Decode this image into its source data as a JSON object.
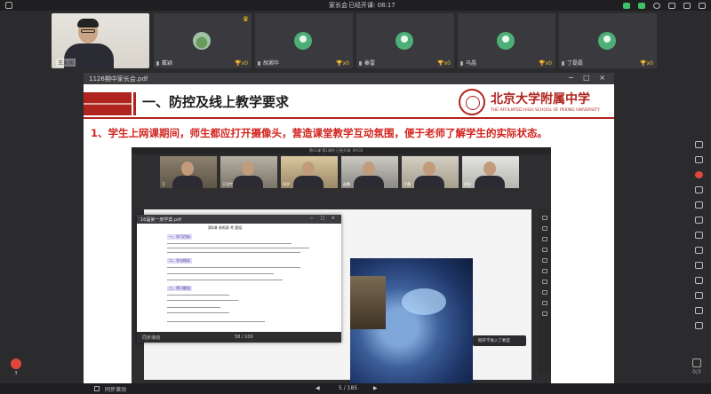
{
  "topbar": {
    "title": "家长会",
    "timer": "已经开课: 08:17"
  },
  "participants": [
    {
      "name": "王永国",
      "type": "video"
    },
    {
      "name": "戴颖",
      "type": "photo",
      "trophies": "x0",
      "host": true
    },
    {
      "name": "胡湘华",
      "type": "avatar",
      "trophies": "x0"
    },
    {
      "name": "秦雷",
      "type": "avatar",
      "trophies": "x0"
    },
    {
      "name": "马晶",
      "type": "avatar",
      "trophies": "x0"
    },
    {
      "name": "丁磊磊",
      "type": "avatar",
      "trophies": "x0"
    }
  ],
  "pdf": {
    "filename": "1126期中家长会.pdf",
    "heading": "一、防控及线上教学要求",
    "logo_text": "北京大学附属中学",
    "logo_subtext": "THE AFFILIATED HIGH SCHOOL OF PEKING UNIVERSITY",
    "point": "1、学生上网课期间，师生都应打开摄像头，营造课堂教学互动氛围，便于老师了解学生的实际状态。"
  },
  "inner": {
    "toolbar_title": "第n1课  第1课时    已经开课: 09:03",
    "toast": "刚开学进入了教室",
    "mini_names": [
      "王",
      "王浩宇",
      "同学",
      "赵鹏",
      "子墨",
      "同学"
    ]
  },
  "doc": {
    "filename": "16届第一册学案.pdf",
    "title": "第8课  参照表  考  题组",
    "sections": [
      "一、学习目标",
      "二、学法指导",
      "三、预习题组"
    ],
    "sync": "同步滚动",
    "page": "58 / 100"
  },
  "bottom": {
    "sync": "同步滚动",
    "page": "5 / 185"
  },
  "leftfile": {
    "count": "3"
  },
  "pagebtm": {
    "label": "0/3"
  }
}
